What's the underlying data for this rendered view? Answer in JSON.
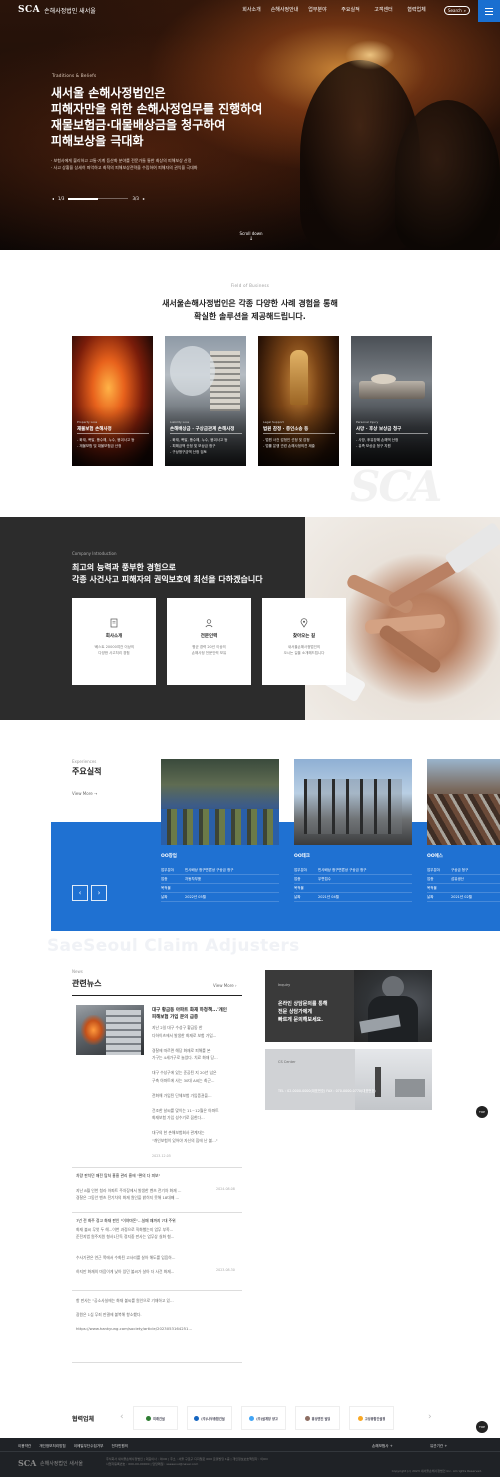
{
  "header": {
    "logo_mark": "SCA",
    "logo_text": "손해사정법인 새서울",
    "nav": [
      "회사소개",
      "손해사정안내",
      "업무분야",
      "주요실적",
      "고객센터",
      "협력업체"
    ],
    "search_label": "Search"
  },
  "hero": {
    "eyebrow": "Traditions & Beliefs",
    "title_lines": [
      "새서울 손해사정법인은",
      "피해자만을 위한 손해사정업무를 진행하여",
      "재물보험금·대물배상금을 청구하여",
      "피해보상을 극대화"
    ],
    "bullets": [
      "· 보험사에게 불리하고 고통·기계 등산화 분야를 전문가들 통한 최상의 피해보상 산정",
      "· 사고 상황을 상세히 파악하고 최적의 피해보상전략을 수립하여 피해자의 권익을 극대화"
    ],
    "slide_current": "1/3",
    "slide_total": "3/3",
    "progress": 0.5,
    "scroll_label": "Scroll down"
  },
  "business": {
    "eyebrow": "Field of Business",
    "title_lines": [
      "새서울손해사정법인은 각종 다양한 사례 경험을 통해",
      "확실한 솔루션을 제공해드립니다."
    ],
    "watermark": "SCA",
    "cards": [
      {
        "eyebrow": "Property Loss",
        "title": "재물보험 손해사정",
        "desc": [
          "- 화재, 폭발, 풍수해, 누수, 붕괴사고 등",
          "- 재물보험 및 대물보험금 산정"
        ]
      },
      {
        "eyebrow": "Liability Loss",
        "title": "손해배상금 · 구상금관계 손해사정",
        "desc": [
          "- 화재, 폭발, 풍수해, 누수, 붕괴사고 등",
          "- 피해금액 산정 및 보상금 청구",
          "- 구상청구금액 산정 검토"
        ]
      },
      {
        "eyebrow": "Legal Support",
        "title": "법원 감정 · 증인소송 등",
        "desc": [
          "- 법원 사건 감정인 선정 및 감정",
          "- 법률 분쟁 관련 손해사정의견 제출"
        ]
      },
      {
        "eyebrow": "Personal Injury",
        "title": "사망 · 후상 보상금 청구",
        "desc": [
          "- 사망, 후유장해 손해액 산정",
          "- 유족 보상금 청구 지원"
        ]
      }
    ]
  },
  "intro": {
    "eyebrow": "Company Introduction",
    "title_lines": [
      "최고의 능력과 풍부한 경험으로",
      "각종 사건사고 피해자의 권익보호에 최선을 다하겠습니다"
    ],
    "cards": [
      {
        "icon": "document-icon",
        "title": "회사소개",
        "desc": [
          "'베스트 20000여건 이상의",
          "다양한 사고처리 경험"
        ]
      },
      {
        "icon": "person-icon",
        "title": "전문인력",
        "desc": [
          "평균 경력 20년 이상의",
          "손해사정 전문인력 보유"
        ]
      },
      {
        "icon": "map-pin-icon",
        "title": "찾아오는 길",
        "desc": [
          "새서울손해사정법인의",
          "오시는 길을 소개해드립니다"
        ]
      }
    ]
  },
  "experiences": {
    "eyebrow": "Experiences",
    "title": "주요실적",
    "more": "View More",
    "items": [
      {
        "name": "OO창업",
        "rows": [
          [
            "업무분야",
            "민사배상 청구변론상 구상금 청구"
          ],
          [
            "업종",
            "자동차부품"
          ],
          [
            "목적물",
            ""
          ],
          [
            "날짜",
            "2022년 05월"
          ]
        ]
      },
      {
        "name": "OO테크",
        "rows": [
          [
            "업무분야",
            "민사배상 청구변론상 구상금 청구"
          ],
          [
            "업종",
            "우편접수"
          ],
          [
            "목적물",
            ""
          ],
          [
            "날짜",
            "2021년 04월"
          ]
        ]
      },
      {
        "name": "OO에스",
        "rows": [
          [
            "업무분야",
            "구상금 청구"
          ],
          [
            "업종",
            "섬유생산"
          ],
          [
            "목적물",
            ""
          ],
          [
            "날짜",
            "2021년 02월"
          ]
        ]
      }
    ]
  },
  "watermark": "SaeSeoul Claim Adjusters",
  "news": {
    "eyebrow": "News",
    "title": "관련뉴스",
    "more": "View More",
    "feature_title_lines": [
      "대구 황금동 아파트 화재 하청책...'개인",
      "피해보험 가입 문의 급증"
    ],
    "feature_paras": [
      "지난 2일 대구 수성구 황금동 한",
      "다하이츠에서 발생한 화재로 보험 가입...",
      "",
      "경찰에 따르면 해당 화재로 피해를 본",
      "가구는 4세가구로 늘었다. 치료 화재 당...",
      "",
      "대구 수성구에 있는 준공된 지 20년 넘은",
      "구축 아파트에 사는 30대 A씨는 최근...",
      "",
      "전화해 가입된 단체보험 가입증권을...",
      "",
      "건조한 날씨를 맞이는 11~12월은 아파트",
      "화재보험 가입 성수기로 꼽힌다...",
      "",
      "대구의 한 손해보험회사 관계자는",
      "\"개인보험이 있어야 자신의 집에 난 불...\""
    ],
    "feature_date": "2023.12.05",
    "items": [
      {
        "title": "차량 판치던 매전 탐처 흥흥 관리 흥에 \"편의 다 피보\"",
        "lines": [
          "지난 8월 인천 청라 아파트 주차장에서 발생한 벤츠 전기차 화재 ...",
          "경찰은 그동안 벤츠 전기차의 화재 원인을 밝히지 못해 18대째 ..."
        ],
        "date": "2024.08.08"
      },
      {
        "title": "7년 전 화주 정고 화재 판인 \"이야마돈\"...실패 때까지 7대 주위",
        "lines": [
          "화재 불씨 무엇 두 해...이번 과정으로 직화했는지 업무 부족...",
          "준전지법 원주지원 형사1단독 정지중 판사는 업무상 실화 혐...",
          "",
          "수사기관은 연근 쪽에서 수화된 고사리를 살아 해도를 입음하...",
          "하지만 화재의 마음이게 낮아 있던 불씨가 살아 더 사건 화재..."
        ],
        "date": "2023.08.30"
      },
      {
        "title": "",
        "lines": [
          "항 판사는 \"공소사실에는 화재 불씨를 원인으로 기재하고 있...",
          "광원은 1심 무죄 판결에 불복해 항소했다.",
          "",
          "https://www.hankyung.com/society/article/2023053164251..."
        ],
        "date": ""
      }
    ]
  },
  "inquiry": {
    "eyebrow": "Inquiry",
    "title_lines": [
      "온라인 상담문의를 통해",
      "전문 상담가에게",
      "빠르게 문의해보세요."
    ]
  },
  "cs": {
    "eyebrow": "CS Center",
    "line": "TEL : 02-0000-0000(대표번호)   FAX : 070-0000-0770(대표번호)"
  },
  "top_label": "TOP",
  "partners": {
    "title": "협력업체",
    "items": [
      {
        "name": "미래건설",
        "color": "#2e7d32"
      },
      {
        "name": "(주)나우종합건설",
        "color": "#1565c0"
      },
      {
        "name": "(주)설계장 양고",
        "color": "#42a5f5"
      },
      {
        "name": "흥성엔진 빌딩",
        "color": "#8d6e63"
      },
      {
        "name": "고성종합건설정",
        "color": "#f9a825"
      }
    ]
  },
  "footer": {
    "links": [
      "이용약관",
      "개인정보처리방침",
      "이메일무단수집거부",
      "전자민원의"
    ],
    "right_links": [
      "손해보험사",
      "유관기관"
    ],
    "logo_mark": "SCA",
    "logo_text": "손해사정법인 새서울",
    "info_lines": [
      "주식회사 새서울손해사정법인  |  대표이사 : 이OO  |  주소 : 서울 구로구 디지털로 000 로봇빌딩 1층  |  개인정보보호책임자 : 이OO",
      "사업자등록번호 : 000-00-00000  |  담당메일 : saeseoul@naver.com"
    ],
    "copyright": "Copyright (c) 2023 새서울손해사정법인 Inc. All rights Reserved."
  }
}
